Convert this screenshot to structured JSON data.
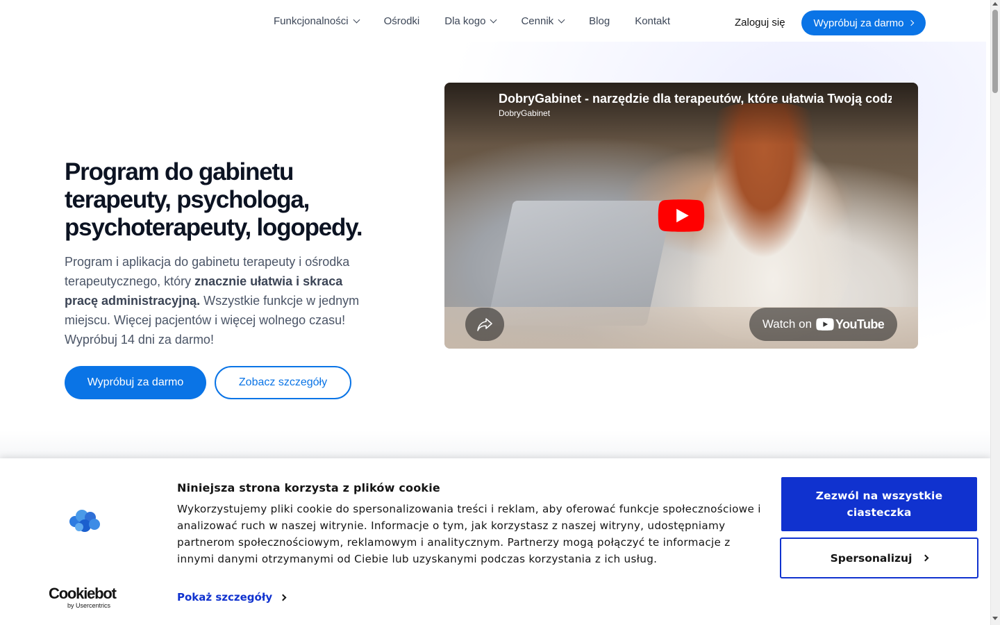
{
  "nav": {
    "items": [
      {
        "label": "Funkcjonalności",
        "has_dropdown": true
      },
      {
        "label": "Ośrodki",
        "has_dropdown": false
      },
      {
        "label": "Dla kogo",
        "has_dropdown": true
      },
      {
        "label": "Cennik",
        "has_dropdown": true
      },
      {
        "label": "Blog",
        "has_dropdown": false
      },
      {
        "label": "Kontakt",
        "has_dropdown": false
      }
    ],
    "login": "Zaloguj się",
    "cta": "Wypróbuj za darmo"
  },
  "hero": {
    "title": "Program do gabinetu terapeuty, psychologa, psychoterapeuty, logopedy.",
    "text_part1": "Program i aplikacja do gabinetu terapeuty i ośrodka terapeutycznego, który ",
    "text_bold": "znacznie ułatwia i skraca pracę administracyjną.",
    "text_part2": " Wszystkie funkcje w jednym miejscu. Więcej pacjentów i więcej wolnego czasu! Wypróbuj 14 dni za darmo!",
    "primary_button": "Wypróbuj za darmo",
    "secondary_button": "Zobacz szczegóły"
  },
  "video": {
    "title": "DobryGabinet - narzędzie dla terapeutów, które ułatwia Twoją codzienną pracę",
    "channel": "DobryGabinet",
    "watch_on": "Watch on",
    "youtube": "YouTube"
  },
  "cookie": {
    "title": "Niniejsza strona korzysta z plików cookie",
    "text": "Wykorzystujemy pliki cookie do spersonalizowania treści i reklam, aby oferować funkcje społecznościowe i analizować ruch w naszej witrynie. Informacje o tym, jak korzystasz z naszej witryny, udostępniamy partnerom społecznościowym, reklamowym i analitycznym. Partnerzy mogą połączyć te informacje z innymi danymi otrzymanymi od Ciebie lub uzyskanymi podczas korzystania z ich usług.",
    "details_link": "Pokaż szczegóły",
    "allow_all": "Zezwól na wszystkie ciasteczka",
    "customize": "Spersonalizuj",
    "brand": "Cookiebot",
    "brand_by": "by Usercentrics"
  },
  "colors": {
    "accent": "#0a74e6",
    "cookie_accent": "#1032cf",
    "youtube_red": "#ff0000"
  }
}
